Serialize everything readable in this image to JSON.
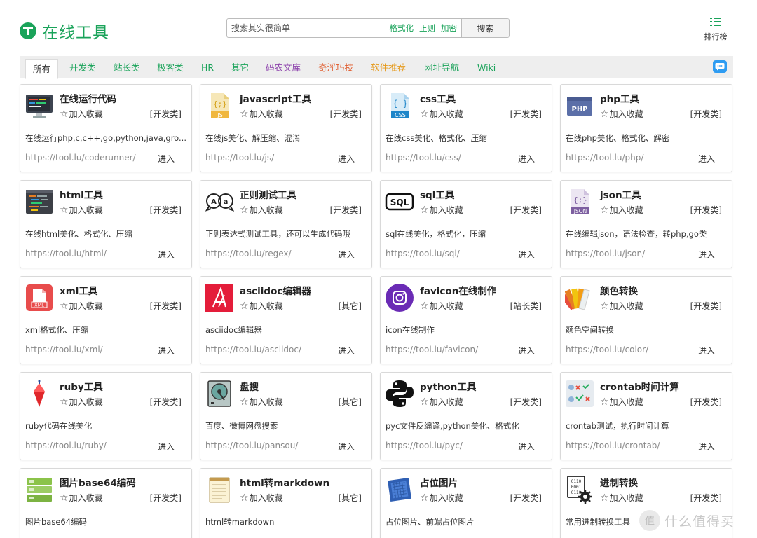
{
  "header": {
    "logo_text": "在线工具",
    "search_placeholder": "搜索其实很简单",
    "search_tags": [
      "格式化",
      "正则",
      "加密"
    ],
    "search_button": "搜索",
    "rank_label": "排行榜"
  },
  "tabs": [
    {
      "label": "所有",
      "color": "#333333",
      "active": true
    },
    {
      "label": "开发类",
      "color": "#1aa35a"
    },
    {
      "label": "站长类",
      "color": "#1aa35a"
    },
    {
      "label": "极客类",
      "color": "#1aa35a"
    },
    {
      "label": "HR",
      "color": "#1aa35a"
    },
    {
      "label": "其它",
      "color": "#1aa35a"
    },
    {
      "label": "码农文库",
      "color": "#8e44ad"
    },
    {
      "label": "奇淫巧技",
      "color": "#e05a2b"
    },
    {
      "label": "软件推荐",
      "color": "#e69a1c"
    },
    {
      "label": "网址导航",
      "color": "#1aa35a"
    },
    {
      "label": "Wiki",
      "color": "#1aa35a"
    }
  ],
  "fav_label": "加入收藏",
  "enter_label": "进入",
  "cards": [
    {
      "title": "在线运行代码",
      "category": "[开发类]",
      "desc": "在线运行php,c,c++,go,python,java,gro...",
      "url": "https://tool.lu/coderunner/",
      "icon": "monitor-code-icon"
    },
    {
      "title": "javascript工具",
      "category": "[开发类]",
      "desc": "在线js美化、解压缩、混淆",
      "url": "https://tool.lu/js/",
      "icon": "js-file-icon",
      "icon_text": "JS"
    },
    {
      "title": "css工具",
      "category": "[开发类]",
      "desc": "在线css美化、格式化、压缩",
      "url": "https://tool.lu/css/",
      "icon": "css-file-icon",
      "icon_text": "CSS"
    },
    {
      "title": "php工具",
      "category": "[开发类]",
      "desc": "在线php美化、格式化、解密",
      "url": "https://tool.lu/php/",
      "icon": "php-window-icon",
      "icon_text": "PHP"
    },
    {
      "title": "html工具",
      "category": "[开发类]",
      "desc": "在线html美化、格式化、压缩",
      "url": "https://tool.lu/html/",
      "icon": "html-code-icon"
    },
    {
      "title": "正则测试工具",
      "category": "[开发类]",
      "desc": "正则表达式测试工具，还可以生成代码哦",
      "url": "https://tool.lu/regex/",
      "icon": "regex-bubbles-icon"
    },
    {
      "title": "sql工具",
      "category": "[开发类]",
      "desc": "sql在线美化，格式化，压缩",
      "url": "https://tool.lu/sql/",
      "icon": "sql-badge-icon",
      "icon_text": "SQL"
    },
    {
      "title": "json工具",
      "category": "[开发类]",
      "desc": "在线编辑json，语法检查，转php,go类",
      "url": "https://tool.lu/json/",
      "icon": "json-file-icon",
      "icon_text": "JSON"
    },
    {
      "title": "xml工具",
      "category": "[开发类]",
      "desc": "xml格式化、压缩",
      "url": "https://tool.lu/xml/",
      "icon": "xml-file-icon",
      "icon_text": "XML"
    },
    {
      "title": "asciidoc编辑器",
      "category": "[其它]",
      "desc": "asciidoc编辑器",
      "url": "https://tool.lu/asciidoc/",
      "icon": "asciidoc-logo-icon"
    },
    {
      "title": "favicon在线制作",
      "category": "[站长类]",
      "desc": "icon在线制作",
      "url": "https://tool.lu/favicon/",
      "icon": "instagram-circle-icon"
    },
    {
      "title": "颜色转换",
      "category": "[开发类]",
      "desc": "颜色空间转换",
      "url": "https://tool.lu/color/",
      "icon": "color-swatches-icon"
    },
    {
      "title": "ruby工具",
      "category": "[开发类]",
      "desc": "ruby代码在线美化",
      "url": "https://tool.lu/ruby/",
      "icon": "ruby-gem-icon"
    },
    {
      "title": "盘搜",
      "category": "[其它]",
      "desc": "百度、微博网盘搜索",
      "url": "https://tool.lu/pansou/",
      "icon": "hard-disk-icon"
    },
    {
      "title": "python工具",
      "category": "[开发类]",
      "desc": "pyc文件反编译,python美化、格式化",
      "url": "https://tool.lu/pyc/",
      "icon": "python-logo-icon"
    },
    {
      "title": "crontab时间计算",
      "category": "[开发类]",
      "desc": "crontab测试，执行时间计算",
      "url": "https://tool.lu/crontab/",
      "icon": "crontab-tasks-icon"
    },
    {
      "title": "图片base64编码",
      "category": "[开发类]",
      "desc": "图片base64编码",
      "url": "",
      "icon": "image-stack-icon"
    },
    {
      "title": "html转markdown",
      "category": "[其它]",
      "desc": "html转markdown",
      "url": "",
      "icon": "notepad-icon"
    },
    {
      "title": "占位图片",
      "category": "[开发类]",
      "desc": "占位图片、前端占位图片",
      "url": "",
      "icon": "placeholder-chip-icon"
    },
    {
      "title": "进制转换",
      "category": "[开发类]",
      "desc": "常用进制转换工具",
      "url": "",
      "icon": "binary-gear-icon",
      "icon_text": "0110 0001 0110"
    }
  ],
  "watermark": {
    "badge": "值",
    "text": "什么值得买"
  }
}
